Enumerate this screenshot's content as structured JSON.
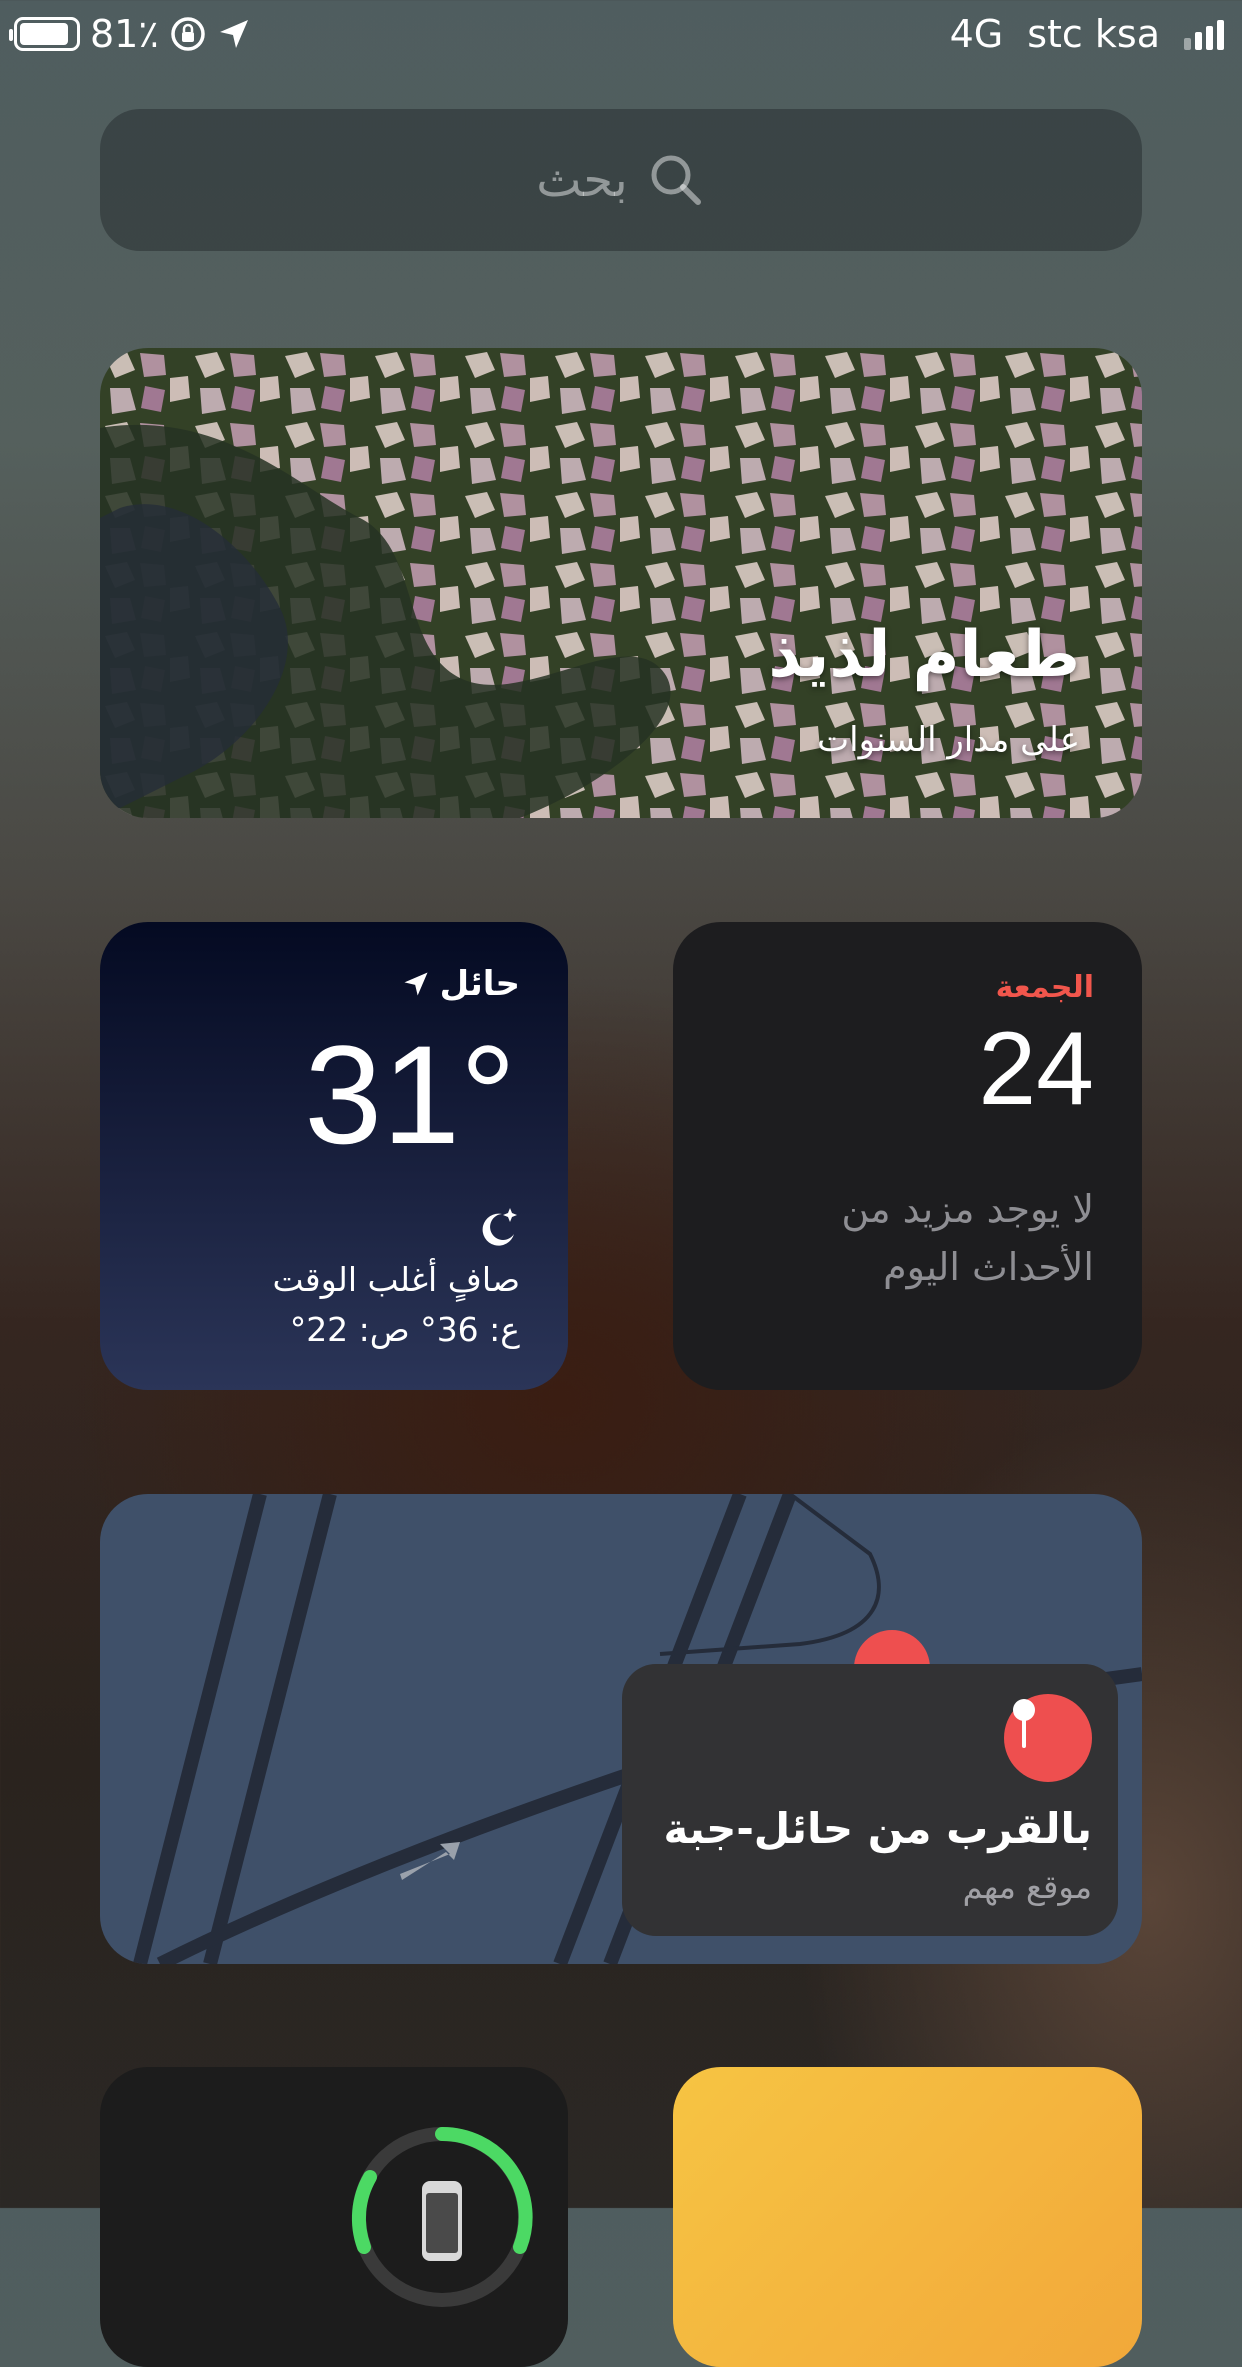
{
  "status_bar": {
    "battery_percent": "81٪",
    "network": "4G",
    "carrier": "stc ksa",
    "signal_bars": 4,
    "icons": [
      "battery-icon",
      "rotation-lock-icon",
      "location-arrow-icon",
      "signal-bars-icon"
    ]
  },
  "search": {
    "placeholder": "بحث",
    "icon": "search-icon"
  },
  "photo_widget": {
    "title": "طعام لذيذ",
    "subtitle": "على مدار السنوات"
  },
  "weather_widget": {
    "city": "حائل",
    "temperature": "31°",
    "condition": "صافٍ أغلب الوقت",
    "high_low": "ع: 36° ص: 22°",
    "icons": [
      "location-arrow-icon",
      "moon-stars-icon"
    ]
  },
  "calendar_widget": {
    "day": "الجمعة",
    "date": "24",
    "no_events": "لا يوجد مزيد من الأحداث اليوم",
    "accent": "#f1564c"
  },
  "maps_widget": {
    "title": "بالقرب من حائل-جبة",
    "subtitle": "موقع مهم",
    "pin_color": "#ee4f4f",
    "icon": "map-pin-icon"
  },
  "battery_widget": {
    "icon": "iphone-icon",
    "ring_color": "#4cd964"
  },
  "notes_widget": {
    "color": "#f6c443"
  }
}
